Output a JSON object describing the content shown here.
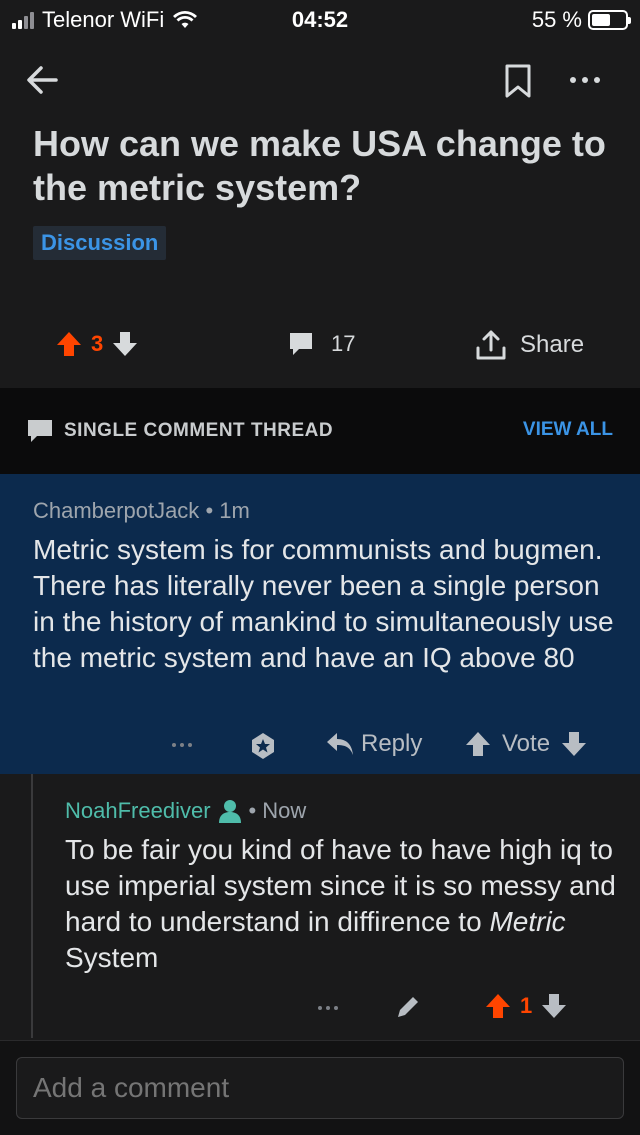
{
  "status_bar": {
    "carrier": "Telenor WiFi",
    "time": "04:52",
    "battery": "55 %",
    "battery_level": 0.55
  },
  "post": {
    "title": "How can we make USA change to the metric system?",
    "flair": "Discussion",
    "score": "3",
    "comments": "17",
    "share_label": "Share"
  },
  "thread": {
    "label": "SINGLE COMMENT THREAD",
    "view_all": "VIEW ALL"
  },
  "comment": {
    "author": "ChamberpotJack",
    "separator": "•",
    "age": "1m",
    "body": "Metric system is for communists and bugmen. There has literally never been a single person in the history of mankind to simultaneously use the metric system and have an IQ above 80",
    "reply_label": "Reply",
    "vote_label": "Vote"
  },
  "reply": {
    "author": "NoahFreediver",
    "separator": "•",
    "age": "Now",
    "body_before": "To be fair you kind of have to have high iq to use imperial system since it is so messy and hard to understand in diffirence to ",
    "body_italic": "Metric",
    "body_after": " System",
    "score": "1"
  },
  "composer": {
    "placeholder": "Add a comment"
  },
  "colors": {
    "upvote": "#ff4500",
    "link": "#3b94e6",
    "highlight_bg": "#0c2a4d",
    "op_author": "#4fbcaa"
  },
  "icons": [
    "back-arrow-icon",
    "bookmark-icon",
    "more-icon",
    "upvote-icon",
    "downvote-icon",
    "comment-icon",
    "share-icon",
    "award-icon",
    "reply-icon",
    "pencil-icon",
    "user-icon"
  ]
}
